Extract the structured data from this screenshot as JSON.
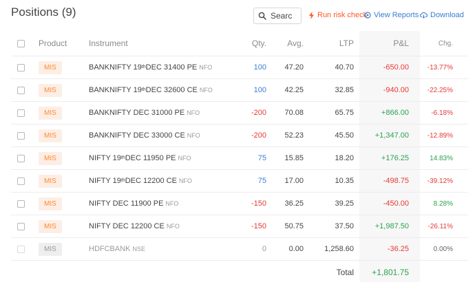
{
  "header": {
    "title": "Positions (9)",
    "search_placeholder": "Searc",
    "risk_label": "Run risk check",
    "reports_label": "View Reports",
    "download_label": "Download"
  },
  "columns": {
    "product": "Product",
    "instrument": "Instrument",
    "qty": "Qty.",
    "avg": "Avg.",
    "ltp": "LTP",
    "pnl": "P&L",
    "chg": "Chg."
  },
  "rows": [
    {
      "product": "MIS",
      "name_a": "BANKNIFTY 19",
      "sup": "th",
      "name_b": " DEC 31400 PE",
      "exchange": "NFO",
      "qty": "100",
      "avg": "47.20",
      "ltp": "40.70",
      "pnl": "-650.00",
      "chg": "-13.77%"
    },
    {
      "product": "MIS",
      "name_a": "BANKNIFTY 19",
      "sup": "th",
      "name_b": " DEC 32600 CE",
      "exchange": "NFO",
      "qty": "100",
      "avg": "42.25",
      "ltp": "32.85",
      "pnl": "-940.00",
      "chg": "-22.25%"
    },
    {
      "product": "MIS",
      "name_a": "BANKNIFTY DEC 31000 PE",
      "sup": "",
      "name_b": "",
      "exchange": "NFO",
      "qty": "-200",
      "avg": "70.08",
      "ltp": "65.75",
      "pnl": "+866.00",
      "chg": "-6.18%"
    },
    {
      "product": "MIS",
      "name_a": "BANKNIFTY DEC 33000 CE",
      "sup": "",
      "name_b": "",
      "exchange": "NFO",
      "qty": "-200",
      "avg": "52.23",
      "ltp": "45.50",
      "pnl": "+1,347.00",
      "chg": "-12.89%"
    },
    {
      "product": "MIS",
      "name_a": "NIFTY 19",
      "sup": "th",
      "name_b": " DEC 11950 PE",
      "exchange": "NFO",
      "qty": "75",
      "avg": "15.85",
      "ltp": "18.20",
      "pnl": "+176.25",
      "chg": "14.83%"
    },
    {
      "product": "MIS",
      "name_a": "NIFTY 19",
      "sup": "th",
      "name_b": " DEC 12200 CE",
      "exchange": "NFO",
      "qty": "75",
      "avg": "17.00",
      "ltp": "10.35",
      "pnl": "-498.75",
      "chg": "-39.12%"
    },
    {
      "product": "MIS",
      "name_a": "NIFTY DEC 11900 PE",
      "sup": "",
      "name_b": "",
      "exchange": "NFO",
      "qty": "-150",
      "avg": "36.25",
      "ltp": "39.25",
      "pnl": "-450.00",
      "chg": "8.28%"
    },
    {
      "product": "MIS",
      "name_a": "NIFTY DEC 12200 CE",
      "sup": "",
      "name_b": "",
      "exchange": "NFO",
      "qty": "-150",
      "avg": "50.75",
      "ltp": "37.50",
      "pnl": "+1,987.50",
      "chg": "-26.11%"
    },
    {
      "product": "MIS",
      "name_a": "HDFCBANK",
      "sup": "",
      "name_b": "",
      "exchange": "NSE",
      "qty": "0",
      "avg": "0.00",
      "ltp": "1,258.60",
      "pnl": "-36.25",
      "chg": "0.00%"
    }
  ],
  "total": {
    "label": "Total",
    "value": "+1,801.75"
  },
  "colors": {
    "positive": "#2aa24f",
    "negative": "#e53935",
    "accent_blue": "#387ed1",
    "accent_orange": "#ff5722"
  }
}
